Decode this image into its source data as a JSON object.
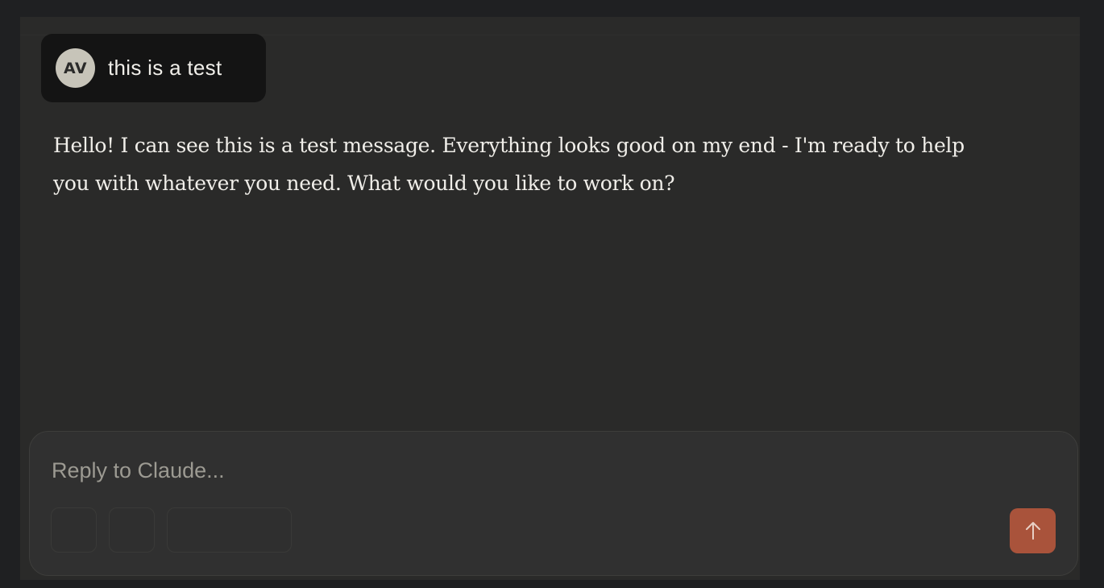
{
  "user_message": {
    "avatar_initials": "AV",
    "text": "this is a test"
  },
  "assistant_message": {
    "text": "Hello! I can see this is a test message. Everything looks good on my end - I'm ready to help you with whatever you need. What would you like to work on?"
  },
  "composer": {
    "placeholder": "Reply to Claude...",
    "value": "",
    "send_icon": "arrow-up-icon",
    "send_color": "#a9533b"
  },
  "colors": {
    "background": "#1f2022",
    "panel": "#2a2a29",
    "user_bubble": "#141414",
    "avatar": "#c7c4b9",
    "text": "#f0eee9",
    "placeholder": "#9c9a92"
  }
}
